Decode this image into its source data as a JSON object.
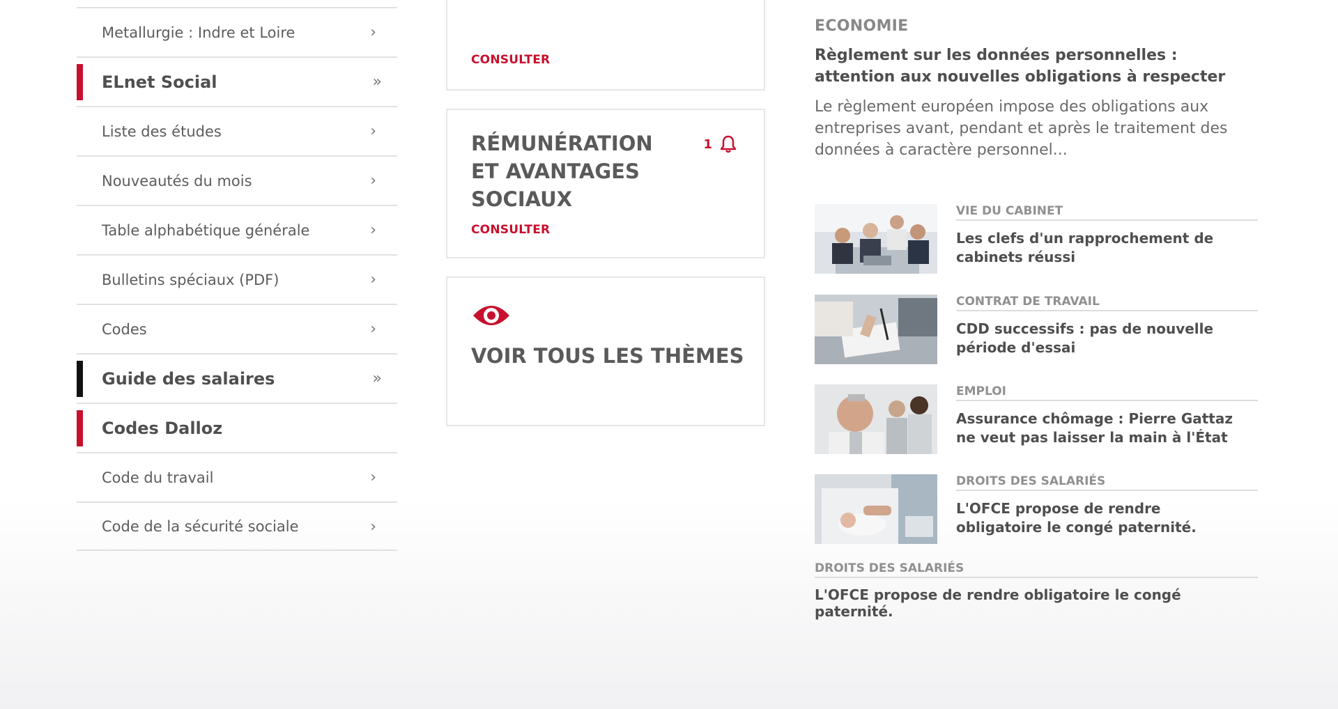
{
  "colors": {
    "accent": "#c8102e",
    "black_marker": "#111111",
    "text": "#555555"
  },
  "left_menu": {
    "items": [
      {
        "label": "Metallurgie : Indre et Loire",
        "type": "link",
        "marker": "",
        "arrow": "›"
      },
      {
        "label": "ELnet Social",
        "type": "section",
        "marker": "red",
        "arrow": "»"
      },
      {
        "label": "Liste des études",
        "type": "link",
        "marker": "",
        "arrow": "›"
      },
      {
        "label": "Nouveautés du mois",
        "type": "link",
        "marker": "",
        "arrow": "›"
      },
      {
        "label": "Table alphabétique générale",
        "type": "link",
        "marker": "",
        "arrow": "›"
      },
      {
        "label": "Bulletins spéciaux (PDF)",
        "type": "link",
        "marker": "",
        "arrow": "›"
      },
      {
        "label": "Codes",
        "type": "link",
        "marker": "",
        "arrow": "›"
      },
      {
        "label": "Guide des salaires",
        "type": "section",
        "marker": "black",
        "arrow": "»"
      },
      {
        "label": "Codes Dalloz",
        "type": "section",
        "marker": "red",
        "arrow": ""
      },
      {
        "label": "Code du travail",
        "type": "link",
        "marker": "",
        "arrow": "›"
      },
      {
        "label": "Code de la sécurité sociale",
        "type": "link",
        "marker": "",
        "arrow": "›"
      }
    ]
  },
  "cards": {
    "top": {
      "consult_label": "CONSULTER"
    },
    "remuneration": {
      "title": "RÉMUNÉRATION ET AVANTAGES SOCIAUX",
      "badge_count": "1",
      "badge_icon": "bell-icon",
      "consult_label": "CONSULTER"
    },
    "all_themes": {
      "title": "VOIR TOUS LES THÈMES",
      "icon": "eye-icon"
    }
  },
  "featured": {
    "category": "ECONOMIE",
    "title": "Règlement sur les données personnelles : attention aux nouvelles obligations à respecter",
    "summary": "Le règlement européen impose des obligations aux entreprises avant, pendant et après le traitement des données à caractère personnel..."
  },
  "news": [
    {
      "category": "VIE DU CABINET",
      "title": "Les clefs d'un rapprochement de cabinets réussi",
      "thumb": "meeting-photo"
    },
    {
      "category": "CONTRAT DE TRAVAIL",
      "title": "CDD successifs : pas de nouvelle période d'essai",
      "thumb": "signing-photo"
    },
    {
      "category": "EMPLOI",
      "title": "Assurance chômage : Pierre Gattaz ne veut pas laisser la main à l'État",
      "thumb": "portrait-photo"
    },
    {
      "category": "DROITS DES SALARIÉS",
      "title": "L'OFCE propose de rendre obligatoire le congé paternité.",
      "thumb": "father-baby-photo"
    }
  ],
  "last_news": {
    "category": "DROITS DES SALARIÉS",
    "title": "L'OFCE propose de rendre obligatoire le congé paternité."
  }
}
